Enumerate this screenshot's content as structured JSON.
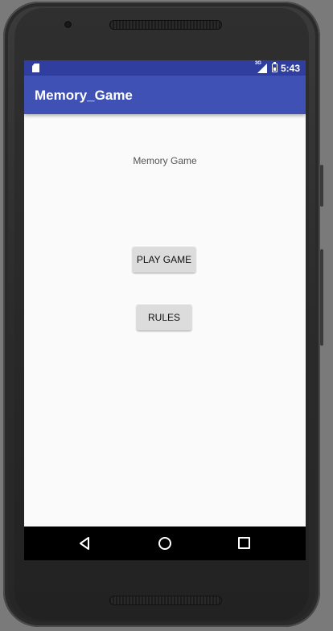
{
  "status_bar": {
    "network": "3G",
    "time": "5:43"
  },
  "app_bar": {
    "title": "Memory_Game"
  },
  "main": {
    "heading": "Memory Game",
    "play_button": "PLAY GAME",
    "rules_button": "RULES"
  },
  "colors": {
    "status_bar": "#303f9f",
    "app_bar": "#3f51b5",
    "screen_bg": "#fafafa",
    "button_bg": "#dcdcdc"
  },
  "icons": {
    "status_left": "sd-card-icon",
    "status_signal": "signal-icon",
    "status_battery": "battery-icon",
    "nav_back": "back-triangle-icon",
    "nav_home": "home-circle-icon",
    "nav_recent": "recent-apps-square-icon"
  }
}
